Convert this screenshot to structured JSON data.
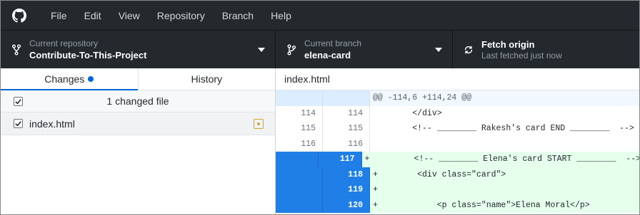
{
  "menu": {
    "items": [
      "File",
      "Edit",
      "View",
      "Repository",
      "Branch",
      "Help"
    ]
  },
  "toolbar": {
    "repo_label": "Current repository",
    "repo_value": "Contribute-To-This-Project",
    "branch_label": "Current branch",
    "branch_value": "elena-card",
    "fetch_label": "Fetch origin",
    "fetch_sub": "Last fetched just now"
  },
  "sidebar": {
    "tabs": {
      "changes": "Changes",
      "history": "History"
    },
    "summary": "1 changed file",
    "files": [
      {
        "name": "index.html",
        "status": "modified"
      }
    ]
  },
  "diff": {
    "filename": "index.html",
    "hunk": "@@ -114,6 +114,24 @@",
    "rows": [
      {
        "old": "114",
        "new": "114",
        "sign": "",
        "code": "        </div>"
      },
      {
        "old": "115",
        "new": "115",
        "sign": "",
        "code": "        <!-- ________ Rakesh's card END ________  -->"
      },
      {
        "old": "116",
        "new": "116",
        "sign": "",
        "code": ""
      },
      {
        "old": "",
        "new": "117",
        "sign": "+",
        "code": "         <!-- ________ Elena's card START ________  -->"
      },
      {
        "old": "",
        "new": "118",
        "sign": "+",
        "code": "        <div class=\"card\">"
      },
      {
        "old": "",
        "new": "119",
        "sign": "+",
        "code": ""
      },
      {
        "old": "",
        "new": "120",
        "sign": "+",
        "code": "            <p class=\"name\">Elena Moral</p>"
      }
    ]
  },
  "colors": {
    "titlebar": "#24292e",
    "accent": "#0366d6",
    "added_gutter": "#1f7fe6",
    "added_bg": "#e6ffed"
  }
}
